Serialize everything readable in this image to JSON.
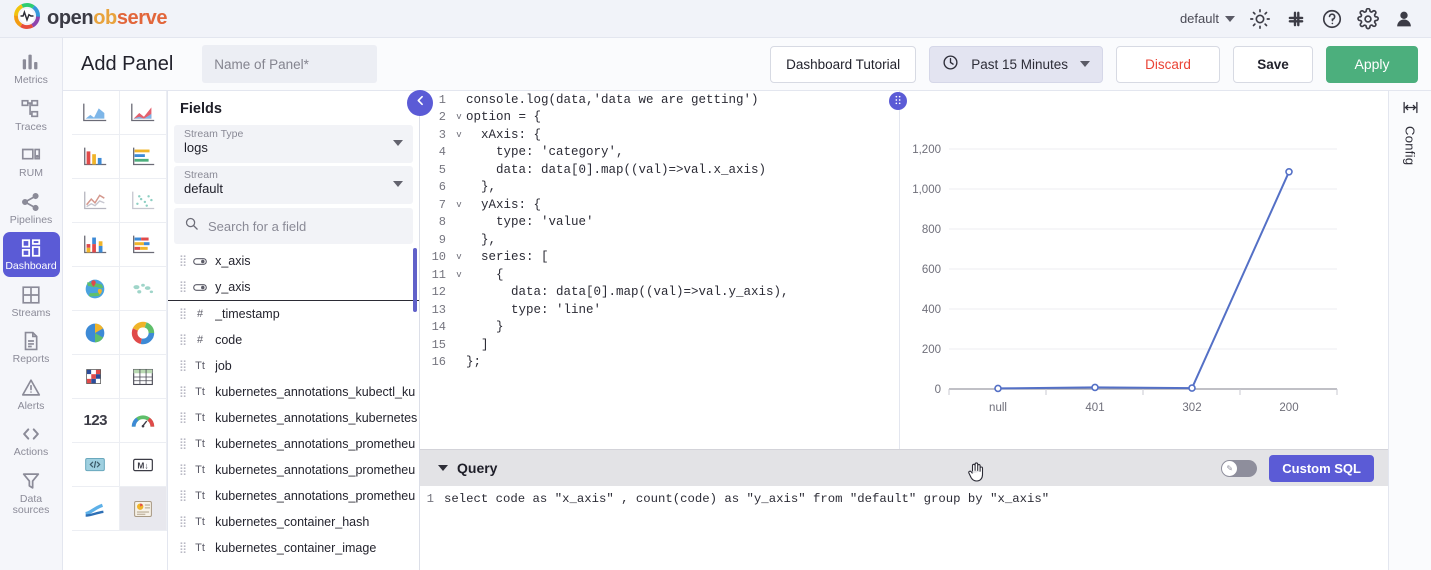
{
  "header": {
    "brand": {
      "part1": "open",
      "part2": "ob",
      "part3": "serve",
      "logo_icon": "openobserve-logo-icon"
    },
    "org": "default",
    "icons": [
      "brightness-icon",
      "slack-icon",
      "help-icon",
      "gear-icon",
      "user-icon"
    ]
  },
  "sidebar": {
    "items": [
      {
        "label": "Metrics",
        "icon": "metrics-icon",
        "active": false
      },
      {
        "label": "Traces",
        "icon": "traces-icon",
        "active": false
      },
      {
        "label": "RUM",
        "icon": "rum-icon",
        "active": false
      },
      {
        "label": "Pipelines",
        "icon": "pipelines-icon",
        "active": false
      },
      {
        "label": "Dashboard",
        "icon": "dashboard-icon",
        "active": true
      },
      {
        "label": "Streams",
        "icon": "streams-icon",
        "active": false
      },
      {
        "label": "Reports",
        "icon": "reports-icon",
        "active": false
      },
      {
        "label": "Alerts",
        "icon": "alerts-icon",
        "active": false
      },
      {
        "label": "Actions",
        "icon": "actions-icon",
        "active": false
      },
      {
        "label": "Data sources",
        "icon": "data-sources-icon",
        "active": false
      }
    ]
  },
  "toolbar": {
    "title": "Add Panel",
    "panel_name_placeholder": "Name of Panel*",
    "panel_name_value": "",
    "tutorial_label": "Dashboard Tutorial",
    "time_range": "Past 15 Minutes",
    "discard_label": "Discard",
    "save_label": "Save",
    "apply_label": "Apply",
    "accent_apply": "#4caf7d",
    "accent_discard": "#ea4335"
  },
  "palette": {
    "items": [
      {
        "icon": "area-chart-icon",
        "selected": false
      },
      {
        "icon": "stacked-area-chart-icon",
        "selected": false
      },
      {
        "icon": "bar-chart-icon",
        "selected": false
      },
      {
        "icon": "horizontal-bar-chart-icon",
        "selected": false
      },
      {
        "icon": "line-chart-icon",
        "selected": false
      },
      {
        "icon": "scatter-chart-icon",
        "selected": false
      },
      {
        "icon": "stacked-bar-chart-icon",
        "selected": false
      },
      {
        "icon": "stacked-horizontal-bar-icon",
        "selected": false
      },
      {
        "icon": "geomap-icon",
        "selected": false
      },
      {
        "icon": "world-map-icon",
        "selected": false
      },
      {
        "icon": "pie-chart-icon",
        "selected": false
      },
      {
        "icon": "donut-chart-icon",
        "selected": false
      },
      {
        "icon": "heatmap-icon",
        "selected": false
      },
      {
        "icon": "table-icon",
        "selected": false
      },
      {
        "icon": "metric-number-icon",
        "selected": false
      },
      {
        "icon": "gauge-icon",
        "selected": false
      },
      {
        "icon": "html-code-icon",
        "selected": false
      },
      {
        "icon": "markdown-icon",
        "selected": false
      },
      {
        "icon": "sankey-icon",
        "selected": false
      },
      {
        "icon": "custom-chart-icon",
        "selected": true
      }
    ],
    "metric_glyph": "123",
    "markdown_glyph": "M↓"
  },
  "fields": {
    "title": "Fields",
    "stream_type_label": "Stream Type",
    "stream_type_value": "logs",
    "stream_label": "Stream",
    "stream_value": "default",
    "search_placeholder": "Search for a field",
    "search_value": "",
    "list": [
      {
        "name": "x_axis",
        "type": "toggle"
      },
      {
        "name": "y_axis",
        "type": "toggle"
      },
      {
        "name": "_timestamp",
        "type": "#"
      },
      {
        "name": "code",
        "type": "#"
      },
      {
        "name": "job",
        "type": "Tt"
      },
      {
        "name": "kubernetes_annotations_kubectl_ku",
        "type": "Tt"
      },
      {
        "name": "kubernetes_annotations_kubernetes",
        "type": "Tt"
      },
      {
        "name": "kubernetes_annotations_prometheu",
        "type": "Tt"
      },
      {
        "name": "kubernetes_annotations_prometheu",
        "type": "Tt"
      },
      {
        "name": "kubernetes_annotations_prometheu",
        "type": "Tt"
      },
      {
        "name": "kubernetes_container_hash",
        "type": "Tt"
      },
      {
        "name": "kubernetes_container_image",
        "type": "Tt"
      }
    ],
    "collapse_icon": "chevron-left-icon"
  },
  "editor": {
    "lines": [
      {
        "n": "1",
        "fold": "",
        "code": "console.log(data,'data we are getting')"
      },
      {
        "n": "2",
        "fold": "v",
        "code": "option = {"
      },
      {
        "n": "3",
        "fold": "v",
        "code": "  xAxis: {"
      },
      {
        "n": "4",
        "fold": "",
        "code": "    type: 'category',"
      },
      {
        "n": "5",
        "fold": "",
        "code": "    data: data[0].map((val)=>val.x_axis)"
      },
      {
        "n": "6",
        "fold": "",
        "code": "  },"
      },
      {
        "n": "7",
        "fold": "v",
        "code": "  yAxis: {"
      },
      {
        "n": "8",
        "fold": "",
        "code": "    type: 'value'"
      },
      {
        "n": "9",
        "fold": "",
        "code": "  },"
      },
      {
        "n": "10",
        "fold": "v",
        "code": "  series: ["
      },
      {
        "n": "11",
        "fold": "v",
        "code": "    {"
      },
      {
        "n": "12",
        "fold": "",
        "code": "      data: data[0].map((val)=>val.y_axis),"
      },
      {
        "n": "13",
        "fold": "",
        "code": "      type: 'line'"
      },
      {
        "n": "14",
        "fold": "",
        "code": "    }"
      },
      {
        "n": "15",
        "fold": "",
        "code": "  ]"
      },
      {
        "n": "16",
        "fold": "",
        "code": "};"
      }
    ],
    "drag_handle_icon": "drag-handle-icon"
  },
  "chart_data": {
    "type": "line",
    "title": "",
    "xlabel": "",
    "ylabel": "",
    "categories": [
      "null",
      "401",
      "302",
      "200"
    ],
    "values": [
      3,
      8,
      4,
      1085
    ],
    "ylim": [
      0,
      1200
    ],
    "yticks": [
      0,
      200,
      400,
      600,
      800,
      1000,
      1200
    ],
    "ytick_labels": [
      "0",
      "200",
      "400",
      "600",
      "800",
      "1,000",
      "1,200"
    ],
    "series": [
      {
        "name": "y_axis",
        "values": [
          3,
          8,
          4,
          1085
        ],
        "color": "#5470c6"
      }
    ],
    "grid": true,
    "legend": "none",
    "line_color": "#5470c6",
    "marker": "circle"
  },
  "query": {
    "title": "Query",
    "collapse_icon": "caret-down-icon",
    "toggle_on": false,
    "custom_sql_label": "Custom SQL",
    "sql_line_number": "1",
    "sql": "select code as \"x_axis\" , count(code) as \"y_axis\" from \"default\" group by \"x_axis\"",
    "cursor_icon": "pointing-hand-cursor"
  },
  "config": {
    "label": "Config",
    "icon": "resize-width-icon"
  }
}
